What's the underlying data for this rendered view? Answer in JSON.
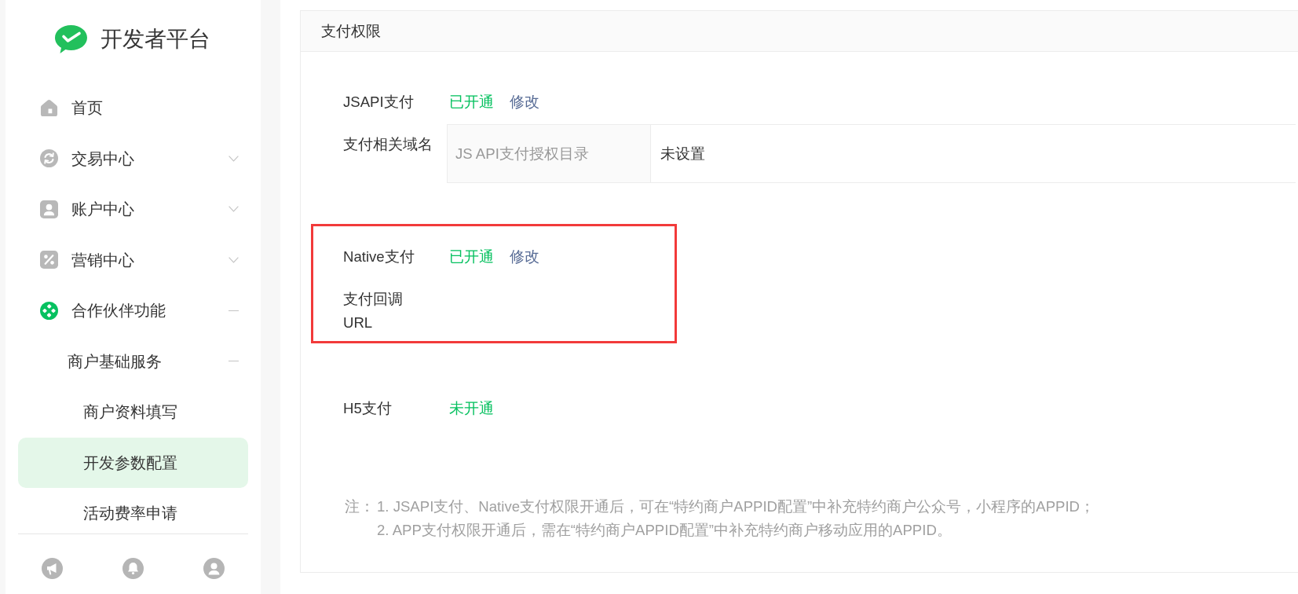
{
  "sidebar": {
    "logo": {
      "title": "开发者平台"
    },
    "nav": [
      {
        "label": "首页",
        "active": false
      },
      {
        "label": "交易中心",
        "active": false,
        "expanded": false
      },
      {
        "label": "账户中心",
        "active": false,
        "expanded": false
      },
      {
        "label": "营销中心",
        "active": false,
        "expanded": false
      },
      {
        "label": "合作伙伴功能",
        "active": true,
        "expanded": true,
        "children": [
          {
            "label": "商户基础服务",
            "expanded": true,
            "children": [
              {
                "label": "商户资料填写",
                "selected": false
              },
              {
                "label": "开发参数配置",
                "selected": true
              },
              {
                "label": "活动费率申请",
                "selected": false
              }
            ]
          }
        ]
      }
    ]
  },
  "panel": {
    "title": "支付权限",
    "permissions": [
      {
        "name": "JSAPI支付",
        "status": "已开通",
        "action": "修改",
        "highlighted": false,
        "settings": [
          {
            "label": "支付相关域名",
            "fields": [
              {
                "key": "JS API支付授权目录",
                "value": "未设置"
              }
            ]
          }
        ]
      },
      {
        "name": "Native支付",
        "status": "已开通",
        "action": "修改",
        "highlighted": true,
        "settings": [
          {
            "label": "支付回调 URL"
          }
        ]
      },
      {
        "name": "H5支付",
        "status": "未开通",
        "highlighted": false
      }
    ],
    "notes": {
      "label": "注：",
      "lines": [
        "1. JSAPI支付、Native支付权限开通后，可在“特约商户APPID配置”中补充特约商户公众号，小程序的APPID；",
        "2. APP支付权限开通后，需在“特约商户APPID配置”中补充特约商户移动应用的APPID。"
      ]
    }
  }
}
